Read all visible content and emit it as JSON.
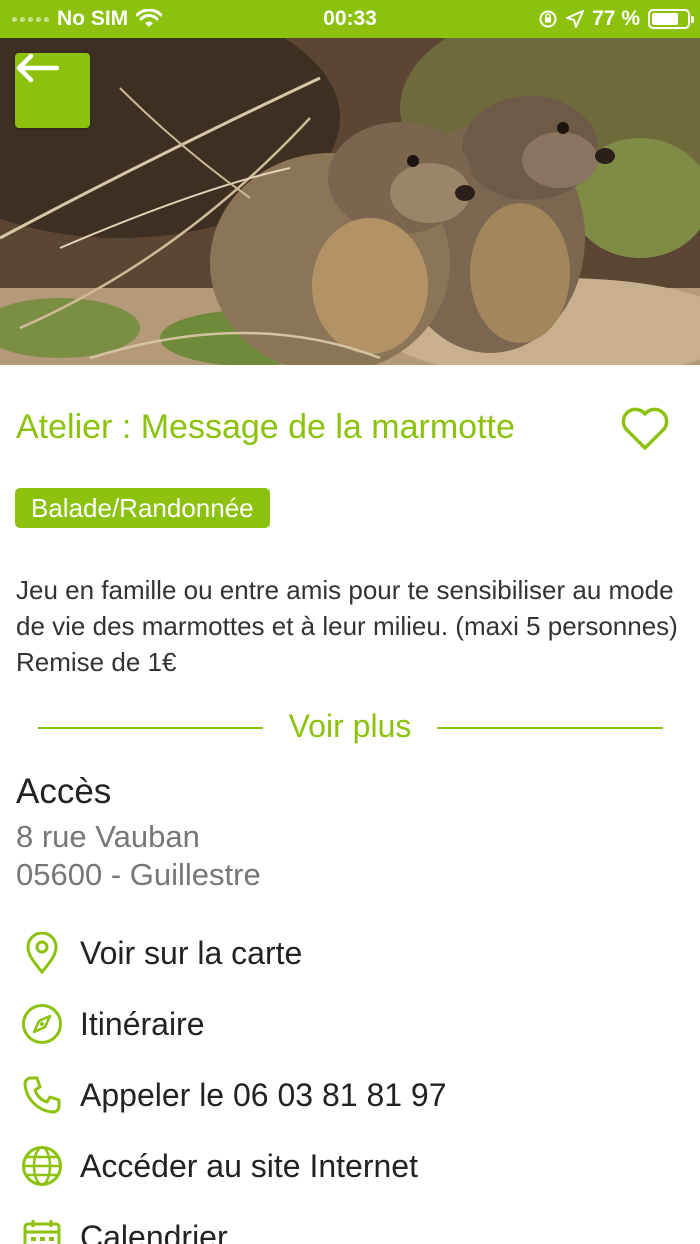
{
  "status_bar": {
    "carrier": "No SIM",
    "time": "00:33",
    "battery_percent": "77 %",
    "battery_level": 0.77,
    "icons": [
      "wifi-icon",
      "orientation-lock-icon",
      "location-icon",
      "battery-icon"
    ]
  },
  "colors": {
    "accent": "#8cc20e",
    "text": "#222222",
    "muted": "#777777"
  },
  "hero": {
    "image_subject": "two marmots"
  },
  "activity": {
    "title": "Atelier : Message de la marmotte",
    "category": "Balade/Randonnée",
    "description": "Jeu en famille ou entre amis pour te sensibiliser au mode de vie des marmottes et à leur milieu.  (maxi 5 personnes) Remise de 1€",
    "voir_plus": "Voir plus"
  },
  "access": {
    "heading": "Accès",
    "street": "8 rue Vauban",
    "city": "05600 - Guillestre"
  },
  "actions": [
    {
      "label": "Voir sur la carte",
      "icon": "map-pin-icon"
    },
    {
      "label": "Itinéraire",
      "icon": "compass-icon"
    },
    {
      "label": "Appeler le 06 03 81 81 97",
      "icon": "phone-icon"
    },
    {
      "label": "Accéder au site Internet",
      "icon": "globe-icon"
    },
    {
      "label": "Calendrier",
      "icon": "calendar-icon"
    }
  ]
}
